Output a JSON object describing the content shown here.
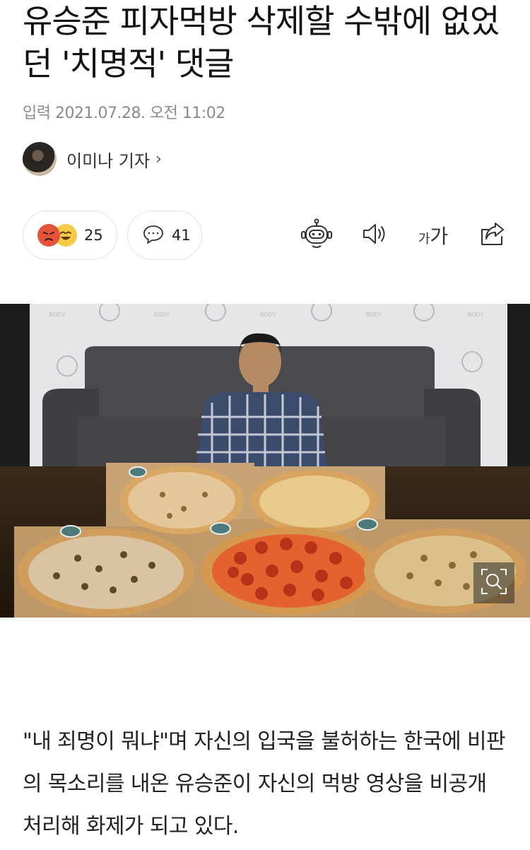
{
  "article": {
    "title": "유승준 피자먹방 삭제할 수밖에 없었던 '치명적' 댓글",
    "date": "입력 2021.07.28. 오전 11:02",
    "reporter": "이미나 기자",
    "reporter_chevron": "›",
    "body": "\"내 죄명이 뭐냐\"며 자신의 입국을 불허하는 한국에 비판의 목소리를 내온 유승준이 자신의 먹방 영상을 비공개 처리해 화제가 되고 있다."
  },
  "actions": {
    "reaction_count": "25",
    "comment_count": "41",
    "font_small": "가",
    "font_big": "가"
  },
  "icons": {
    "reaction1": "angry-face-icon",
    "reaction2": "laughing-face-icon",
    "comment": "speech-bubble-icon",
    "robot": "robot-summary-icon",
    "speaker": "speaker-icon",
    "font": "font-size-icon",
    "share": "share-icon",
    "zoom": "zoom-icon"
  },
  "colors": {
    "angry": "#e5533a",
    "laugh": "#f7c948",
    "meta_gray": "#8a8a8a"
  }
}
